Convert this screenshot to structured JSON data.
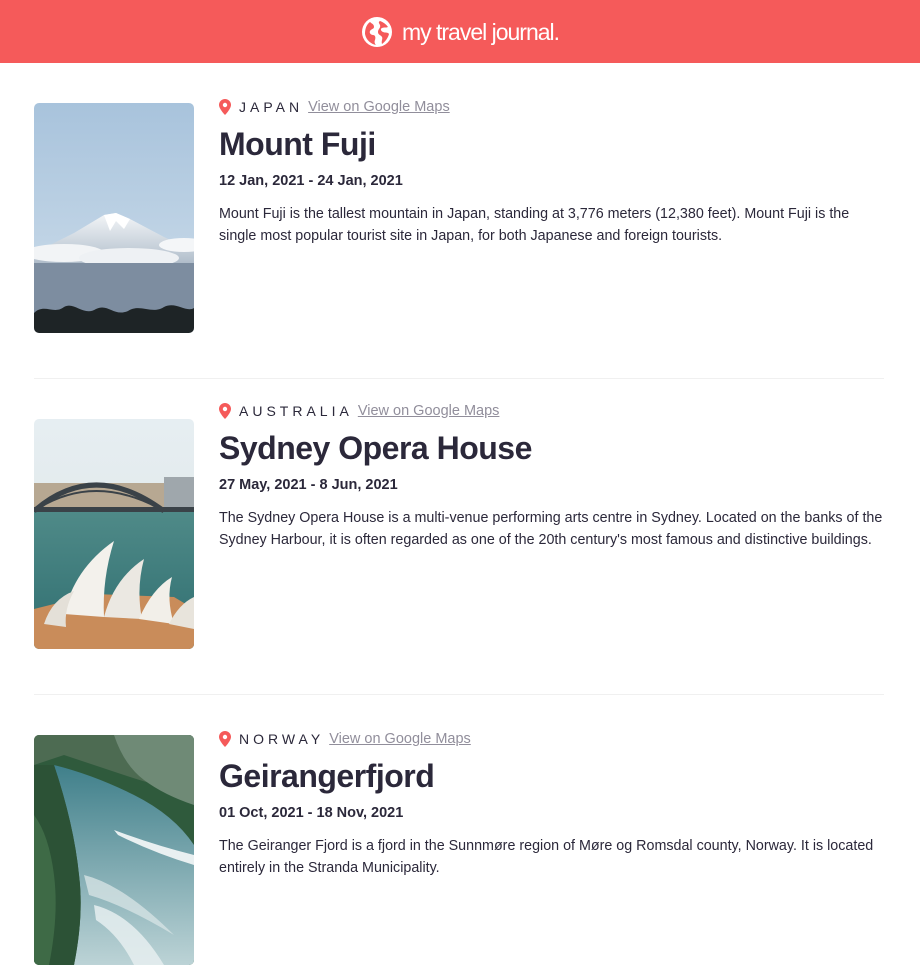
{
  "header": {
    "brand": "my travel journal.",
    "icon": "globe-icon",
    "color": "#f55a5a"
  },
  "entries": [
    {
      "country": "JAPAN",
      "maps_label": "View on Google Maps",
      "title": "Mount Fuji",
      "dates": "12 Jan, 2021 - 24 Jan, 2021",
      "description": "Mount Fuji is the tallest mountain in Japan, standing at 3,776 meters (12,380 feet). Mount Fuji is the single most popular tourist site in Japan, for both Japanese and foreign tourists.",
      "image": "mount-fuji-photo"
    },
    {
      "country": "AUSTRALIA",
      "maps_label": "View on Google Maps",
      "title": "Sydney Opera House",
      "dates": "27 May, 2021 - 8 Jun, 2021",
      "description": "The Sydney Opera House is a multi-venue performing arts centre in Sydney. Located on the banks of the Sydney Harbour, it is often regarded as one of the 20th century's most famous and distinctive buildings.",
      "image": "sydney-opera-house-photo"
    },
    {
      "country": "NORWAY",
      "maps_label": "View on Google Maps",
      "title": "Geirangerfjord",
      "dates": "01 Oct, 2021 - 18 Nov, 2021",
      "description": "The Geiranger Fjord is a fjord in the Sunnmøre region of Møre og Romsdal county, Norway. It is located entirely in the Stranda Municipality.",
      "image": "geirangerfjord-photo"
    }
  ]
}
